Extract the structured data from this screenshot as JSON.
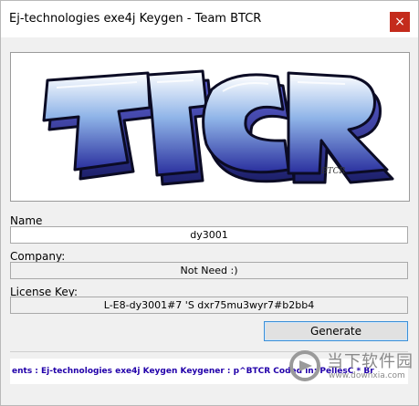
{
  "window": {
    "title": "Ej-technologies exe4j Keygen - Team BTCR",
    "close_glyph": "×"
  },
  "banner": {
    "logo_text": "BTCR",
    "signature": "BTCR",
    "colors": {
      "fill_top": "#ffffff",
      "fill_mid": "#8fb4e8",
      "fill_bottom": "#2a2f9e",
      "outline": "#0b0b24"
    }
  },
  "form": {
    "name_label": "Name",
    "name_value": "dy3001",
    "company_label": "Company:",
    "company_value": "Not Need :)",
    "license_label": "License Key:",
    "license_value": "L-E8-dy3001#7 'S   dxr75mu3wyr7#b2bb4"
  },
  "actions": {
    "generate_label": "Generate"
  },
  "marquee": {
    "text": "ents : Ej-technologies exe4j Keygen        Keygener : p^BTCR     Coded in: PellesC     * Br"
  },
  "watermark": {
    "title": "当下软件园",
    "url": "www.downxia.com"
  }
}
